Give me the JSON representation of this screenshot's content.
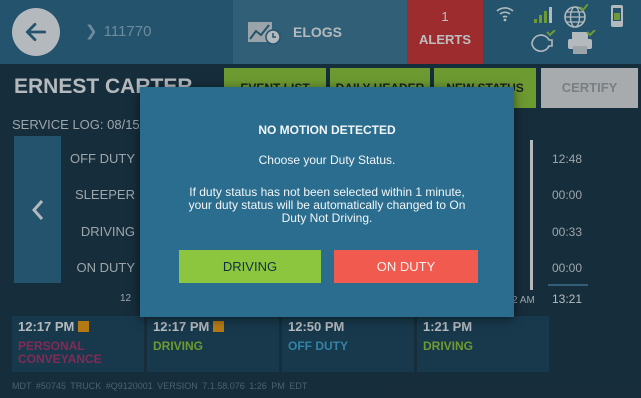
{
  "topbar": {
    "driver_id": "111770",
    "elogs_label": "ELOGS",
    "alerts_count": "1",
    "alerts_label": "ALERTS"
  },
  "header": {
    "driver_name": "ERNEST CARTER",
    "tabs": [
      "EVENT LIST",
      "DAILY HEADER",
      "NEW STATUS"
    ],
    "certify_label": "CERTIFY",
    "service_log": "SERVICE LOG: 08/15/"
  },
  "graph": {
    "status_labels": [
      "OFF DUTY",
      "SLEEPER",
      "DRIVING",
      "ON DUTY"
    ],
    "totals": [
      "12:48",
      "00:00",
      "00:33",
      "00:00"
    ],
    "total_sum": "13:21",
    "axis_left": "12",
    "axis_right": "2 AM"
  },
  "events": [
    {
      "time": "12:17 PM",
      "status": "PERSONAL CONVEYANCE",
      "marker": true,
      "color": "#a8356e"
    },
    {
      "time": "12:17 PM",
      "status": "DRIVING",
      "marker": true,
      "color": "#8cc63f"
    },
    {
      "time": "12:50 PM",
      "status": "OFF DUTY",
      "marker": false,
      "color": "#3fa9d6"
    },
    {
      "time": "1:21 PM",
      "status": "DRIVING",
      "marker": false,
      "color": "#8cc63f"
    }
  ],
  "footer": "MDT #50745   TRUCK #Q9120001   VERSION  7.1.58.076    1:26 PM EDT",
  "modal": {
    "title": "NO MOTION DETECTED",
    "prompt": "Choose your Duty Status.",
    "body": "If duty status has not been selected within 1 minute, your duty status will be automatically changed to On Duty Not Driving.",
    "driving_label": "DRIVING",
    "on_duty_label": "ON DUTY"
  },
  "colors": {
    "topbar": "#2e6b8c",
    "background": "#1d3a4c",
    "tab_green": "#8cc63f",
    "alerts_red": "#c8393a",
    "on_duty_red": "#f05a4f"
  }
}
